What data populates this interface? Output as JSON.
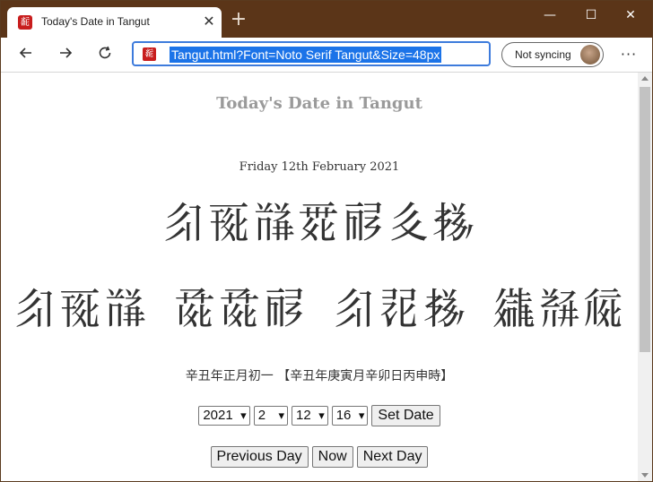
{
  "browser": {
    "tab_title": "Today's Date in Tangut",
    "tab_favicon_glyph": "𘂋",
    "new_tab_symbol": "+",
    "address_url": "Tangut.html?Font=Noto Serif Tangut&Size=48px",
    "sync_label": "Not syncing",
    "window_controls": {
      "minimize": "—",
      "maximize": "☐",
      "close": "✕"
    }
  },
  "page": {
    "title": "Today's Date in Tangut",
    "date_english": "Friday 12th February 2021",
    "tangut_line1": "𗼃𗀔𘁪𗴲𗟲𗢨𗈪",
    "tangut_line2": [
      "𗼃𗀔𘁪",
      "𗱕𗱕𗟲",
      "𗼃𗕿𗈪",
      "𗪘𘃣𗏁"
    ],
    "cyclical_chinese": "辛丑年正月初一 【辛丑年庚寅月辛卯日丙申時】",
    "selects": {
      "year": "2021",
      "month": "2",
      "day": "12",
      "hour": "16"
    },
    "buttons": {
      "set_date": "Set Date",
      "previous_day": "Previous Day",
      "now": "Now",
      "next_day": "Next Day"
    }
  },
  "colors": {
    "titlebar": "#5b3518",
    "address_highlight": "#1b73e8",
    "title_gray": "#9a9a9a"
  }
}
